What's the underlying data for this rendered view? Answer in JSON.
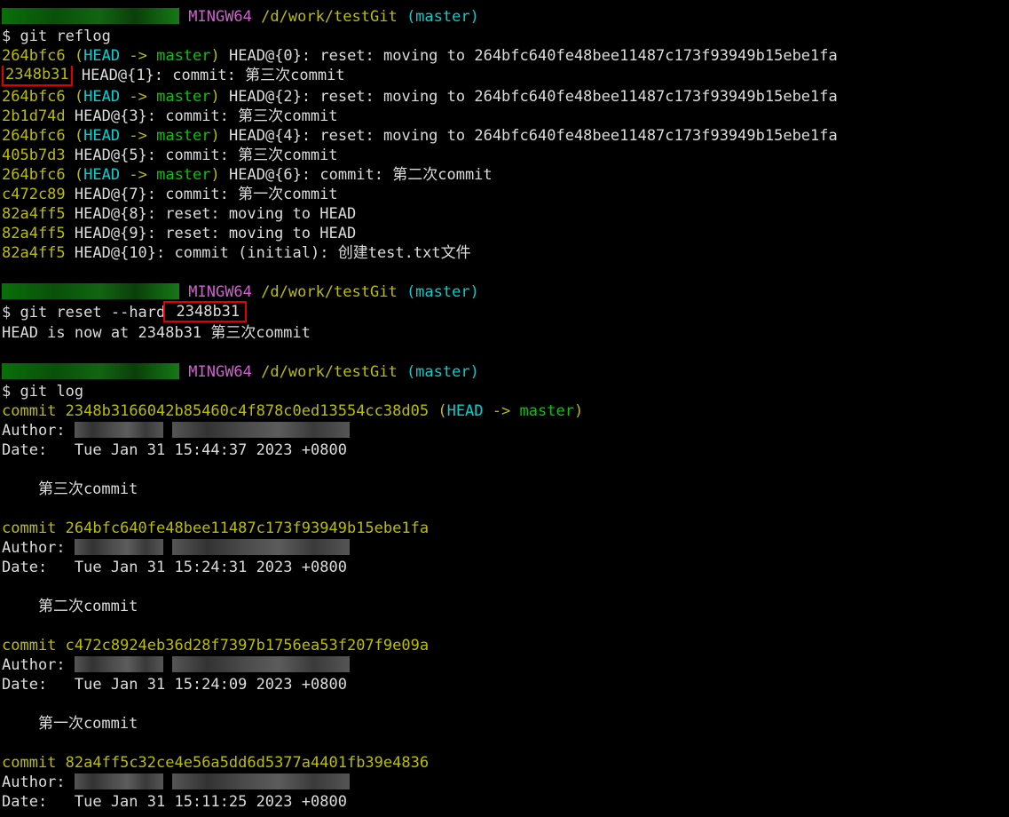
{
  "ref_decor": {
    "open": "(",
    "head": "HEAD",
    "arrow": "->",
    "branch": "master",
    "close": ")"
  },
  "prompts": [
    {
      "env": "MINGW64",
      "path": "/d/work/testGit",
      "branch": "(master)",
      "symbol": "$",
      "command": "git reflog"
    },
    {
      "env": "MINGW64",
      "path": "/d/work/testGit",
      "branch": "(master)",
      "symbol": "$",
      "command_prefix": "git reset --hard",
      "command_arg": " 2348b31"
    },
    {
      "env": "MINGW64",
      "path": "/d/work/testGit",
      "branch": "(master)",
      "symbol": "$",
      "command": "git log"
    }
  ],
  "reflog": [
    {
      "hash": "264bfc6",
      "text": "HEAD@{0}: reset: moving to 264bfc640fe48bee11487c173f93949b15ebe1fa"
    },
    {
      "hash": "2348b31",
      "text": "HEAD@{1}: commit: 第三次commit"
    },
    {
      "hash": "264bfc6",
      "text": "HEAD@{2}: reset: moving to 264bfc640fe48bee11487c173f93949b15ebe1fa"
    },
    {
      "hash": "2b1d74d",
      "text": "HEAD@{3}: commit: 第三次commit"
    },
    {
      "hash": "264bfc6",
      "text": "HEAD@{4}: reset: moving to 264bfc640fe48bee11487c173f93949b15ebe1fa"
    },
    {
      "hash": "405b7d3",
      "text": "HEAD@{5}: commit: 第三次commit"
    },
    {
      "hash": "264bfc6",
      "text": "HEAD@{6}: commit: 第二次commit"
    },
    {
      "hash": "c472c89",
      "text": "HEAD@{7}: commit: 第一次commit"
    },
    {
      "hash": "82a4ff5",
      "text": "HEAD@{8}: reset: moving to HEAD"
    },
    {
      "hash": "82a4ff5",
      "text": "HEAD@{9}: reset: moving to HEAD"
    },
    {
      "hash": "82a4ff5",
      "text": "HEAD@{10}: commit (initial): 创建test.txt文件"
    }
  ],
  "reset_output": "HEAD is now at 2348b31 第三次commit",
  "log": [
    {
      "commit_prefix": "commit",
      "hash": "2348b3166042b85460c4f878c0ed13554cc38d05",
      "author_label": "Author:",
      "date_line": "Date:   Tue Jan 31 15:44:37 2023 +0800",
      "message": "    第三次commit"
    },
    {
      "commit_prefix": "commit",
      "hash": "264bfc640fe48bee11487c173f93949b15ebe1fa",
      "author_label": "Author:",
      "date_line": "Date:   Tue Jan 31 15:24:31 2023 +0800",
      "message": "    第二次commit"
    },
    {
      "commit_prefix": "commit",
      "hash": "c472c8924eb36d28f7397b1756ea53f207f9e09a",
      "author_label": "Author:",
      "date_line": "Date:   Tue Jan 31 15:24:09 2023 +0800",
      "message": "    第一次commit"
    },
    {
      "commit_prefix": "commit",
      "hash": "82a4ff5c32ce4e56a5dd6d5377a4401fb39e4836",
      "author_label": "Author:",
      "date_line": "Date:   Tue Jan 31 15:11:25 2023 +0800",
      "message": ""
    }
  ]
}
